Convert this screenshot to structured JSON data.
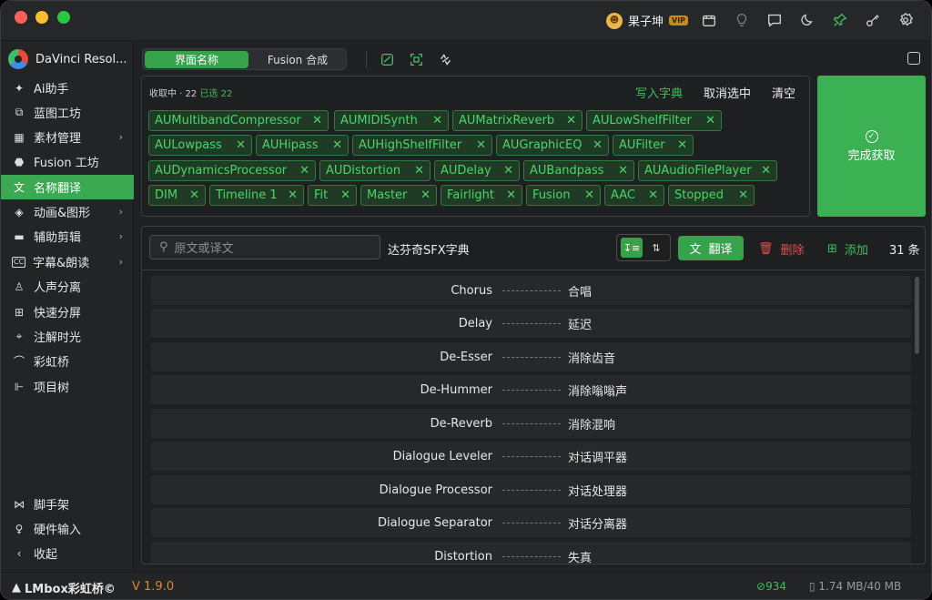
{
  "user": {
    "name": "果子坤",
    "badge": "VIP"
  },
  "sidebar": {
    "brand": "DaVinci Resol...",
    "items": [
      {
        "label": "Ai助手",
        "icon": "ai-icon",
        "has_children": false
      },
      {
        "label": "蓝图工坊",
        "icon": "blueprint-icon",
        "has_children": false
      },
      {
        "label": "素材管理",
        "icon": "assets-icon",
        "has_children": true
      },
      {
        "label": "Fusion 工坊",
        "icon": "fusion-icon",
        "has_children": false
      },
      {
        "label": "名称翻译",
        "icon": "translate-icon",
        "has_children": false,
        "active": true
      },
      {
        "label": "动画&图形",
        "icon": "animation-icon",
        "has_children": true
      },
      {
        "label": "辅助剪辑",
        "icon": "edit-assist-icon",
        "has_children": true
      },
      {
        "label": "字幕&朗读",
        "icon": "subtitle-icon",
        "has_children": true
      },
      {
        "label": "人声分离",
        "icon": "voice-separation-icon",
        "has_children": false
      },
      {
        "label": "快速分屏",
        "icon": "split-screen-icon",
        "has_children": false
      },
      {
        "label": "注解时光",
        "icon": "annotation-icon",
        "has_children": false
      },
      {
        "label": "彩虹桥",
        "icon": "rainbow-bridge-icon",
        "has_children": false
      },
      {
        "label": "项目树",
        "icon": "project-tree-icon",
        "has_children": false
      }
    ],
    "bottom_items": [
      {
        "label": "脚手架",
        "icon": "scaffold-icon"
      },
      {
        "label": "硬件输入",
        "icon": "joystick-icon"
      },
      {
        "label": "收起",
        "icon": "collapse-icon"
      }
    ]
  },
  "tabs": [
    {
      "label": "界面名称",
      "active": true
    },
    {
      "label": "Fusion 合成",
      "active": false
    }
  ],
  "collect": {
    "status": "收取中 · 22",
    "selected": "已选 22",
    "write_label": "写入字典",
    "deselect_label": "取消选中",
    "clear_label": "清空",
    "done_label": "完成获取",
    "tags": [
      "AUMultibandCompressor",
      "AUMIDISynth",
      "AUMatrixReverb",
      "AULowShelfFilter",
      "AULowpass",
      "AUHipass",
      "AUHighShelfFilter",
      "AUGraphicEQ",
      "AUFilter",
      "AUDynamicsProcessor",
      "AUDistortion",
      "AUDelay",
      "AUBandpass",
      "AUAudioFilePlayer",
      "DIM",
      "Timeline 1",
      "Fit",
      "Master",
      "Fairlight",
      "Fusion",
      "AAC",
      "Stopped"
    ]
  },
  "dictionary": {
    "search_placeholder": "原文或译文",
    "name": "达芬奇SFX字典",
    "translate_label": "翻译",
    "delete_label": "删除",
    "add_label": "添加",
    "count": "31 条",
    "entries": [
      {
        "en": "Chorus",
        "zh": "合唱"
      },
      {
        "en": "Delay",
        "zh": "延迟"
      },
      {
        "en": "De-Esser",
        "zh": "消除齿音"
      },
      {
        "en": "De-Hummer",
        "zh": "消除嗡嗡声"
      },
      {
        "en": "De-Reverb",
        "zh": "消除混响"
      },
      {
        "en": "Dialogue Leveler",
        "zh": "对话调平器"
      },
      {
        "en": "Dialogue Processor",
        "zh": "对话处理器"
      },
      {
        "en": "Dialogue Separator",
        "zh": "对话分离器"
      },
      {
        "en": "Distortion",
        "zh": "失真"
      }
    ]
  },
  "status": {
    "logo": "LMbox彩虹桥©",
    "version": "V 1.9.0",
    "count": "934",
    "memory": "1.74 MB/40 MB"
  },
  "colors": {
    "accent": "#37a24c",
    "danger": "#e05050",
    "version": "#d98a2c"
  }
}
